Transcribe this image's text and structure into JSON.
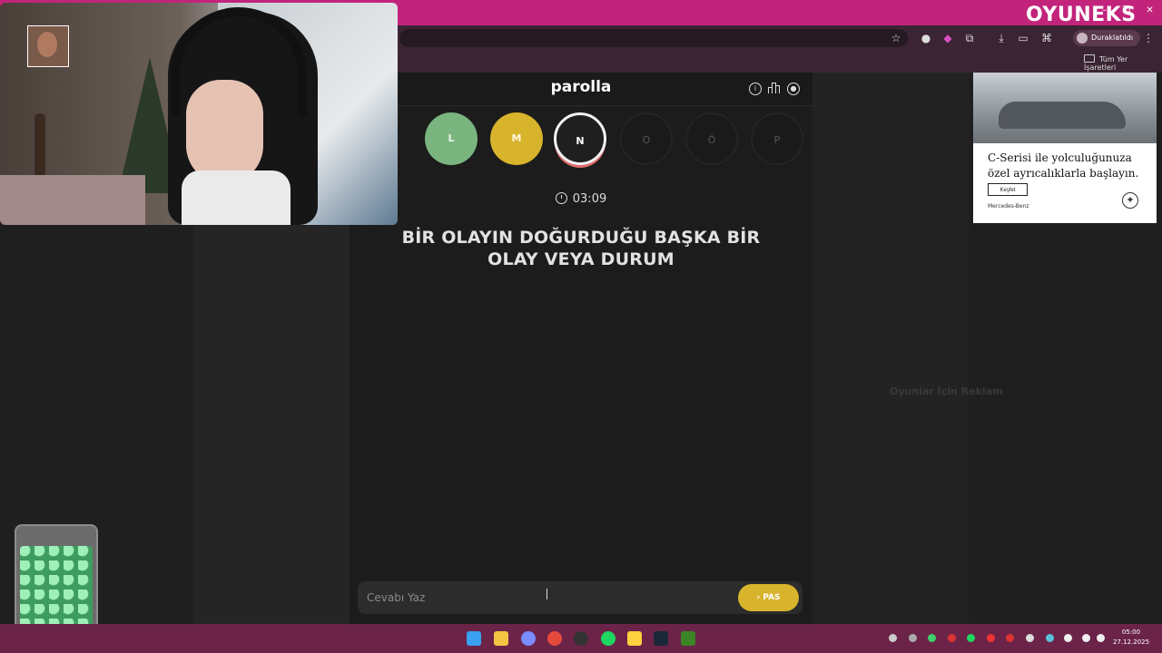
{
  "browser": {
    "site_logo": "OYUNEKS",
    "profile_label": "Duraklatıldı",
    "bookmarks_all": "Tüm Yer İşaretleri",
    "window_controls": [
      "–",
      "❐",
      "✕"
    ]
  },
  "game": {
    "title": "parolla",
    "timer": "03:09",
    "question": "BİR OLAYIN DOĞURDUĞU BAŞKA BİR OLAY VEYA DURUM",
    "letters": [
      {
        "char": "",
        "state": "correct"
      },
      {
        "char": "L",
        "state": "correct"
      },
      {
        "char": "M",
        "state": "passed"
      },
      {
        "char": "N",
        "state": "current"
      },
      {
        "char": "O",
        "state": "pending"
      },
      {
        "char": "Ö",
        "state": "pending"
      },
      {
        "char": "P",
        "state": "pending"
      }
    ],
    "answer_placeholder": "Cevabı Yaz",
    "pass_label": "PAS"
  },
  "header_icons": [
    "info-icon",
    "stats-icon",
    "user-icon"
  ],
  "ad": {
    "headline": "C-Serisi ile yolculuğunuza özel ayrıcalıklarla başlayın.",
    "button": "Keşfet",
    "brand": "Mercedes-Benz",
    "logo": "✦"
  },
  "faded_text": "Oyunlar İçin Reklam",
  "taskbar": {
    "time": "05:00",
    "date": "27.12.2025"
  },
  "colors": {
    "titlebar": "#c2247c",
    "correct": "#7ab580",
    "passed": "#d8b32c",
    "taskbar": "#6b2448"
  }
}
